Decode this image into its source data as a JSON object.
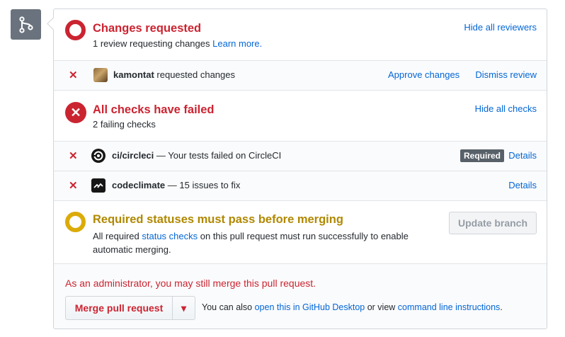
{
  "review": {
    "title": "Changes requested",
    "subtitle": "1 review requesting changes",
    "learn_more": "Learn more.",
    "hide_reviewers": "Hide all reviewers",
    "reviewer": {
      "name": "kamontat",
      "action": " requested changes",
      "approve": "Approve changes",
      "dismiss": "Dismiss review"
    }
  },
  "checks": {
    "title": "All checks have failed",
    "subtitle": "2 failing checks",
    "hide_checks": "Hide all checks",
    "items": [
      {
        "name": "ci/circleci",
        "description": " — Your tests failed on CircleCI",
        "badge": "Required",
        "details": "Details",
        "logo": "circleci-icon"
      },
      {
        "name": "codeclimate",
        "description": " — 15 issues to fix",
        "details": "Details",
        "logo": "codeclimate-icon"
      }
    ]
  },
  "status": {
    "title": "Required statuses must pass before merging",
    "line1_pre": "All required ",
    "line1_link": "status checks",
    "line1_post": " on this pull request must run successfully to enable",
    "line2": "automatic merging.",
    "update_button": "Update branch"
  },
  "merge": {
    "admin_notice": "As an administrator, you may still merge this pull request.",
    "button": "Merge pull request",
    "dropdown": "▾",
    "also_pre": "You can also ",
    "desktop_link": "open this in GitHub Desktop",
    "or_view": " or view ",
    "cli_link": "command line instructions",
    "period": "."
  },
  "colors": {
    "red": "#cb2431",
    "yellow": "#dbab09",
    "link": "#0366d6"
  }
}
